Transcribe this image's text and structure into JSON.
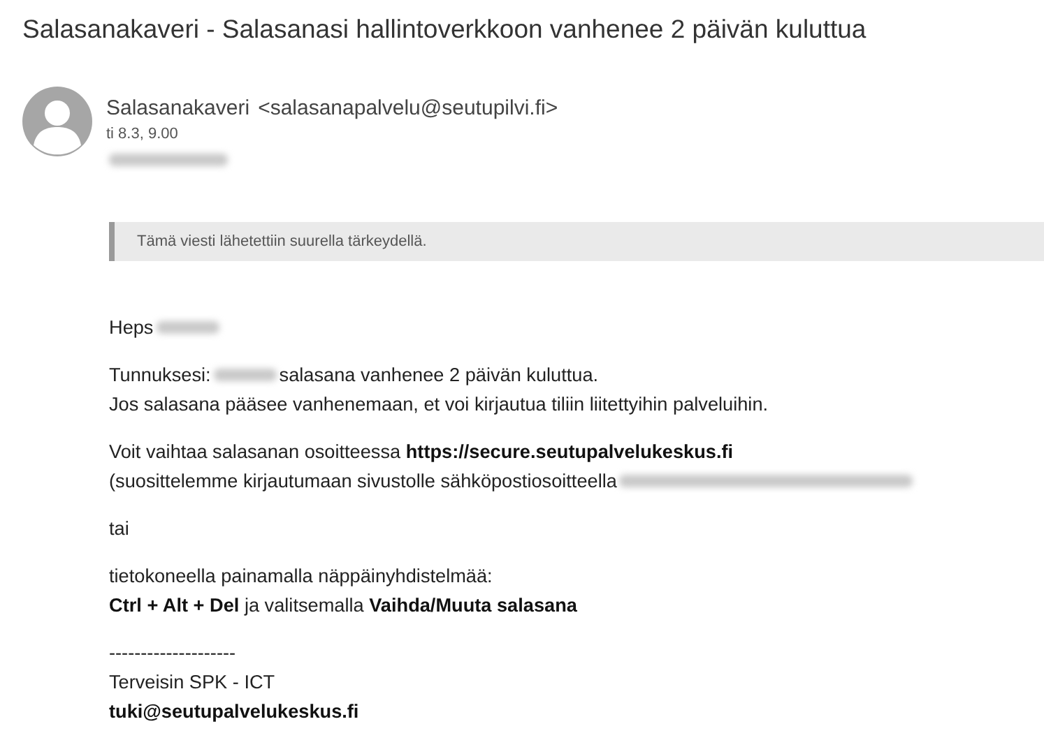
{
  "subject": "Salasanakaveri - Salasanasi hallintoverkkoon vanhenee 2 päivän kuluttua",
  "sender": {
    "name": "Salasanakaveri",
    "email": "<salasanapalvelu@seutupilvi.fi>"
  },
  "date": "ti 8.3, 9.00",
  "recipient_redacted": true,
  "importance_notice": "Tämä viesti lähetettiin suurella tärkeydellä.",
  "paragraphs": [
    {
      "lines": [
        [
          {
            "kind": "text",
            "text": "Heps"
          },
          {
            "kind": "redacted"
          }
        ]
      ]
    },
    {
      "lines": [
        [
          {
            "kind": "text",
            "text": "Tunnuksesi:"
          },
          {
            "kind": "redacted"
          },
          {
            "kind": "text",
            "text": "salasana vanhenee 2 päivän kuluttua."
          }
        ],
        [
          {
            "kind": "text",
            "text": "Jos salasana pääsee vanhenemaan, et voi kirjautua tiliin liitettyihin palveluihin."
          }
        ]
      ]
    },
    {
      "lines": [
        [
          {
            "kind": "text",
            "text": "Voit vaihtaa salasanan osoitteessa **https://secure.seutupalvelukeskus.fi**"
          }
        ],
        [
          {
            "kind": "text",
            "text": "(suosittelemme kirjautumaan sivustolle sähköpostiosoitteella"
          },
          {
            "kind": "redactedlong"
          }
        ]
      ]
    },
    {
      "lines": [
        [
          {
            "kind": "text",
            "text": "tai"
          }
        ]
      ]
    },
    {
      "lines": [
        [
          {
            "kind": "text",
            "text": "tietokoneella painamalla näppäinyhdistelmää:"
          }
        ],
        [
          {
            "kind": "text",
            "text": "**Ctrl + Alt + Del** ja valitsemalla **Vaihda/Muuta salasana**"
          }
        ]
      ]
    },
    {
      "lines": [
        [
          {
            "kind": "text",
            "text": "--------------------"
          }
        ],
        [
          {
            "kind": "text",
            "text": "Terveisin SPK - ICT"
          }
        ],
        [
          {
            "kind": "text",
            "text": "**tuki@seutupalvelukeskus.fi**"
          }
        ]
      ]
    }
  ]
}
